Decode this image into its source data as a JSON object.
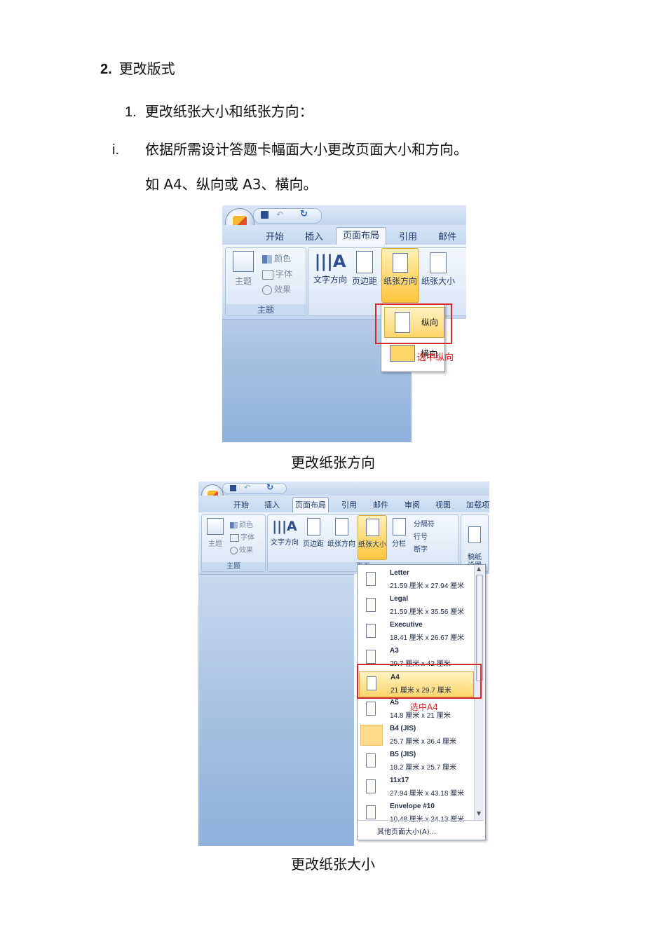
{
  "heading": {
    "number": "2.",
    "text": "更改版式"
  },
  "subheading": {
    "number": "1.",
    "text": "更改纸张大小和纸张方向："
  },
  "step": {
    "number": "i.",
    "text": "依据所需设计答题卡幅面大小更改页面大小和方向。",
    "example": "如 A4、纵向或 A3、横向。"
  },
  "shot1": {
    "tabs": [
      "开始",
      "插入",
      "页面布局",
      "引用",
      "邮件"
    ],
    "active_tab": "页面布局",
    "theme_group": {
      "button": "主题",
      "options": [
        "颜色",
        "字体",
        "效果"
      ],
      "label": "主题"
    },
    "buttons": [
      "文字方向",
      "页边距",
      "纸张方向",
      "纸张大小"
    ],
    "orientation_menu": [
      "纵向",
      "横向"
    ],
    "annotation": "选中纵向",
    "caption": "更改纸张方向"
  },
  "shot2": {
    "tabs": [
      "开始",
      "插入",
      "页面布局",
      "引用",
      "邮件",
      "审阅",
      "视图",
      "加载项"
    ],
    "active_tab": "页面布局",
    "theme_group": {
      "button": "主题",
      "options": [
        "颜色",
        "字体",
        "效果"
      ],
      "label": "主题"
    },
    "buttons": [
      "文字方向",
      "页边距",
      "纸张方向",
      "纸张大小",
      "分栏"
    ],
    "right_options": [
      "分隔符",
      "行号",
      "断字"
    ],
    "draft_button": "稿纸\n设置",
    "group_label_2": "页面",
    "paper_sizes": [
      {
        "name": "Letter",
        "dims": "21.59 厘米 x 27.94 厘米"
      },
      {
        "name": "Legal",
        "dims": "21.59 厘米 x 35.56 厘米"
      },
      {
        "name": "Executive",
        "dims": "18.41 厘米 x 26.67 厘米"
      },
      {
        "name": "A3",
        "dims": "29.7 厘米 x 42 厘米"
      },
      {
        "name": "A4",
        "dims": "21 厘米 x 29.7 厘米"
      },
      {
        "name": "A5",
        "dims": "14.8 厘米 x 21 厘米"
      },
      {
        "name": "B4 (JIS)",
        "dims": "25.7 厘米 x 36.4 厘米"
      },
      {
        "name": "B5 (JIS)",
        "dims": "18.2 厘米 x 25.7 厘米"
      },
      {
        "name": "11x17",
        "dims": "27.94 厘米 x 43.18 厘米"
      },
      {
        "name": "Envelope #10",
        "dims": "10.48 厘米 x 24.13 厘米"
      }
    ],
    "selected_size": "A4",
    "more_sizes": "其他页面大小(A)...",
    "annotation": "选中A4",
    "caption": "更改纸张大小"
  },
  "colors": {
    "highlight": "#ffd56a",
    "annotation": "#d12b2b",
    "ribbon": "#cfdff2"
  }
}
